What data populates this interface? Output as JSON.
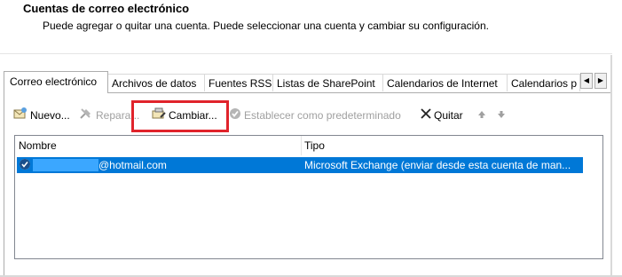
{
  "header": {
    "title": "Cuentas de correo electrónico",
    "subtitle": "Puede agregar o quitar una cuenta. Puede seleccionar una cuenta y cambiar su configuración."
  },
  "tabs": [
    {
      "label": "Correo electrónico",
      "active": true
    },
    {
      "label": "Archivos de datos",
      "active": false
    },
    {
      "label": "Fuentes RSS",
      "active": false
    },
    {
      "label": "Listas de SharePoint",
      "active": false
    },
    {
      "label": "Calendarios de Internet",
      "active": false
    },
    {
      "label": "Calendarios p",
      "active": false
    }
  ],
  "toolbar": {
    "new_label": "Nuevo...",
    "repair_label": "Repara...",
    "change_label": "Cambiar...",
    "set_default_label": "Establecer como predeterminado",
    "remove_label": "Quitar"
  },
  "list": {
    "columns": [
      "Nombre",
      "Tipo"
    ],
    "rows": [
      {
        "name": "@hotmail.com",
        "type": "Microsoft Exchange (enviar desde esta cuenta de man..."
      }
    ]
  },
  "colors": {
    "selection": "#0078d7",
    "highlight_box": "#e0232b"
  }
}
